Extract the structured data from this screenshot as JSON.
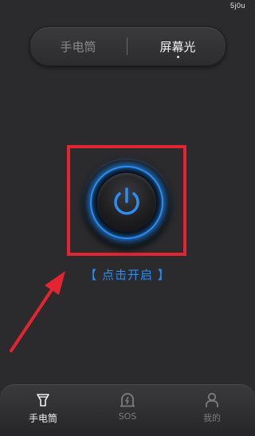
{
  "status": {
    "text": "5j0u"
  },
  "segment": {
    "left_label": "手电筒",
    "right_label": "屏幕光"
  },
  "power": {
    "label": "【 点击开启 】",
    "icon": "power-icon"
  },
  "tabbar": {
    "items": [
      {
        "label": "手电筒",
        "icon": "flashlight-icon",
        "active": true
      },
      {
        "label": "SOS",
        "icon": "sos-lamp-icon",
        "active": false
      },
      {
        "label": "我的",
        "icon": "person-icon",
        "active": false
      }
    ]
  },
  "colors": {
    "accent": "#2a8ef5",
    "highlight": "#e22530",
    "background": "#2b2b2d"
  }
}
